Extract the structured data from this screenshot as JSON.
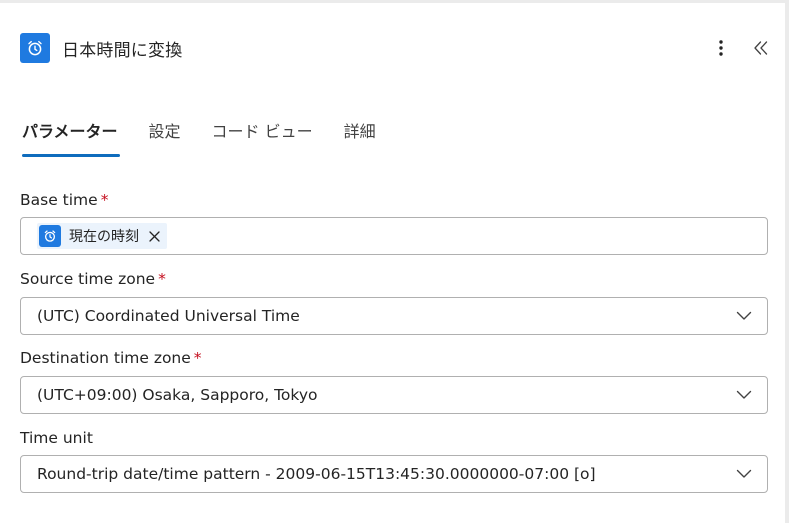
{
  "header": {
    "title": "日本時間に変換",
    "icon": "alarm-clock-icon",
    "more_icon": "more-vertical-icon",
    "collapse_icon": "double-chevron-left-icon",
    "accent_color": "#1f7ae0"
  },
  "tabs": [
    {
      "label": "パラメーター",
      "active": true
    },
    {
      "label": "設定",
      "active": false
    },
    {
      "label": "コード ビュー",
      "active": false
    },
    {
      "label": "詳細",
      "active": false
    }
  ],
  "fields": {
    "base_time": {
      "label": "Base time",
      "required_mark": "*",
      "token": {
        "label": "現在の時刻",
        "icon": "alarm-clock-icon",
        "remove_icon": "close-icon"
      }
    },
    "source_time_zone": {
      "label": "Source time zone",
      "required_mark": "*",
      "value": "(UTC) Coordinated Universal Time"
    },
    "destination_time_zone": {
      "label": "Destination time zone",
      "required_mark": "*",
      "value": "(UTC+09:00) Osaka, Sapporo, Tokyo"
    },
    "time_unit": {
      "label": "Time unit",
      "value": "Round-trip date/time pattern - 2009-06-15T13:45:30.0000000-07:00 [o]"
    }
  },
  "colors": {
    "tab_indicator": "#0f6cbd",
    "required": "#c50f1f",
    "token_background": "#ebf3fc"
  }
}
